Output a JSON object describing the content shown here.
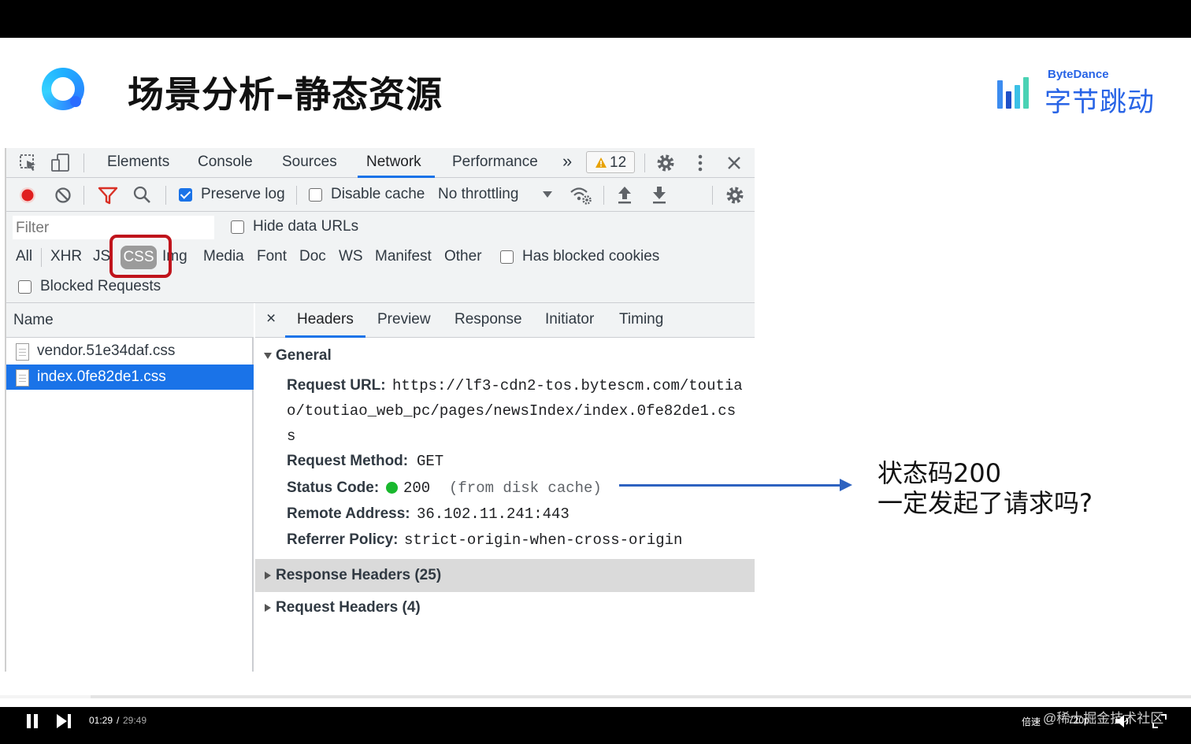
{
  "slide": {
    "title": "场景分析–静态资源",
    "brand_en": "ByteDance",
    "brand_cn": "字节跳动"
  },
  "devtools": {
    "tabs": [
      "Elements",
      "Console",
      "Sources",
      "Network",
      "Performance"
    ],
    "active_tab": "Network",
    "more_label": "»",
    "warning_count": "12",
    "toolbar": {
      "preserve_log": "Preserve log",
      "disable_cache": "Disable cache",
      "throttling": "No throttling"
    },
    "filter": {
      "placeholder": "Filter",
      "hide_data_urls": "Hide data URLs",
      "types": [
        "All",
        "XHR",
        "JS",
        "CSS",
        "Img",
        "Media",
        "Font",
        "Doc",
        "WS",
        "Manifest",
        "Other"
      ],
      "active_type": "CSS",
      "has_blocked_cookies": "Has blocked cookies",
      "blocked_requests": "Blocked Requests"
    },
    "requests": {
      "header": "Name",
      "files": [
        "vendor.51e34daf.css",
        "index.0fe82de1.css"
      ]
    },
    "detail": {
      "close": "×",
      "tabs": [
        "Headers",
        "Preview",
        "Response",
        "Initiator",
        "Timing"
      ],
      "active_tab": "Headers",
      "general_title": "General",
      "request_url_label": "Request URL:",
      "request_url_lines": [
        "https://lf3-cdn2-tos.bytescm.com/toutia",
        "o/toutiao_web_pc/pages/newsIndex/index.0fe82de1.cs",
        "s"
      ],
      "request_method_label": "Request Method:",
      "request_method": "GET",
      "status_code_label": "Status Code:",
      "status_code": "200",
      "status_note": "(from disk cache)",
      "remote_address_label": "Remote Address:",
      "remote_address": "36.102.11.241:443",
      "referrer_policy_label": "Referrer Policy:",
      "referrer_policy": "strict-origin-when-cross-origin",
      "response_headers": "Response Headers (25)",
      "request_headers": "Request Headers (4)"
    }
  },
  "annotation": {
    "line1": "状态码200",
    "line2": "一定发起了请求吗?"
  },
  "player": {
    "current_time": "01:29",
    "separator": "/",
    "duration": "29:49",
    "speed_label": "倍速",
    "watermark": "@稀土掘金技术社区",
    "quality": "720p",
    "progress": 0.05
  },
  "colors": {
    "accent_blue": "#1a73e8",
    "highlight_red": "#c0141c",
    "arrow_blue": "#2d62c0",
    "brand_blue": "#2864e6",
    "status_green": "#19b82e"
  }
}
